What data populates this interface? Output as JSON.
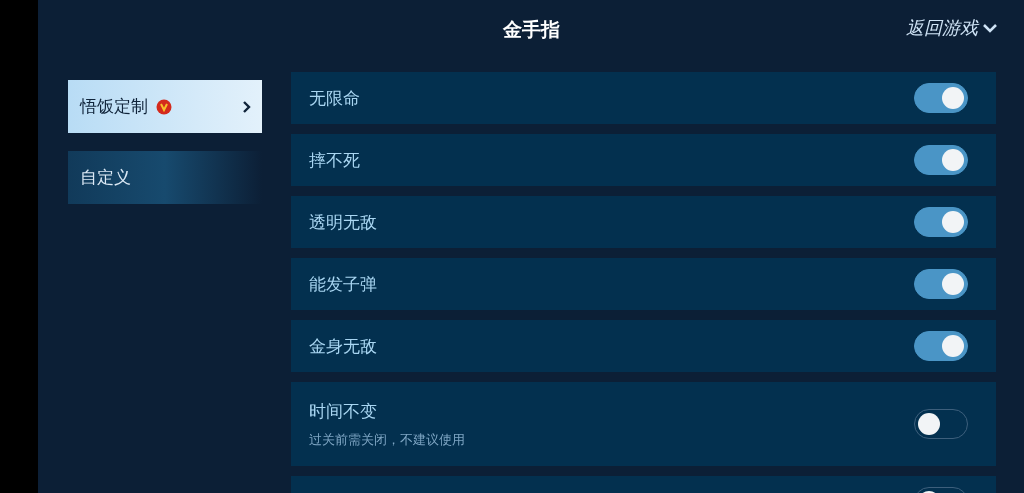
{
  "header": {
    "title": "金手指",
    "back_link": "返回游戏"
  },
  "sidebar": {
    "items": [
      {
        "label": "悟饭定制",
        "selected": true,
        "vip": true
      },
      {
        "label": "自定义",
        "selected": false,
        "vip": false
      }
    ]
  },
  "cheats": [
    {
      "label": "无限命",
      "checked": true
    },
    {
      "label": "摔不死",
      "checked": true
    },
    {
      "label": "透明无敌",
      "checked": true
    },
    {
      "label": "能发子弹",
      "checked": true
    },
    {
      "label": "金身无敌",
      "checked": true
    },
    {
      "label": "时间不变",
      "note": "过关前需关闭，不建议使用",
      "checked": false
    },
    {
      "checked": false
    }
  ]
}
